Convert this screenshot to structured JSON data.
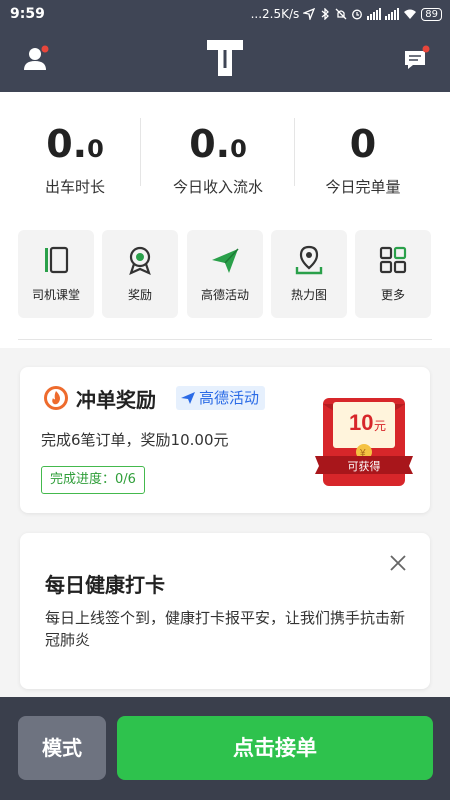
{
  "status_bar": {
    "time": "9:59",
    "net_speed": "...2.5K/s",
    "battery": "89"
  },
  "header": {
    "user_icon": "user-icon",
    "logo_icon": "amap-logo-icon",
    "message_icon": "message-icon",
    "accent": "#3f4555"
  },
  "stats": [
    {
      "value_main": "0.",
      "value_small": "0",
      "label": "出车时长"
    },
    {
      "value_main": "0.",
      "value_small": "0",
      "label": "今日收入流水"
    },
    {
      "value_main": "0",
      "value_small": "",
      "label": "今日完单量"
    }
  ],
  "tiles": [
    {
      "label": "司机课堂",
      "icon": "book-icon"
    },
    {
      "label": "奖励",
      "icon": "medal-icon"
    },
    {
      "label": "高德活动",
      "icon": "paper-plane-icon"
    },
    {
      "label": "热力图",
      "icon": "location-pin-icon"
    },
    {
      "label": "更多",
      "icon": "grid-icon"
    }
  ],
  "reward_card": {
    "title": "冲单奖励",
    "tag": "高德活动",
    "description": "完成6笔订单，奖励10.00元",
    "progress": "完成进度：0/6",
    "packet_amount": "10",
    "packet_unit": "元",
    "packet_yen": "¥",
    "packet_label": "可获得",
    "green": "#2ec24d",
    "red": "#d7262a"
  },
  "health_card": {
    "title": "每日健康打卡",
    "description": "每日上线签个到，健康打卡报平安，让我们携手抗击新冠肺炎"
  },
  "bottom_bar": {
    "mode_label": "模式",
    "take_order_label": "点击接单"
  }
}
